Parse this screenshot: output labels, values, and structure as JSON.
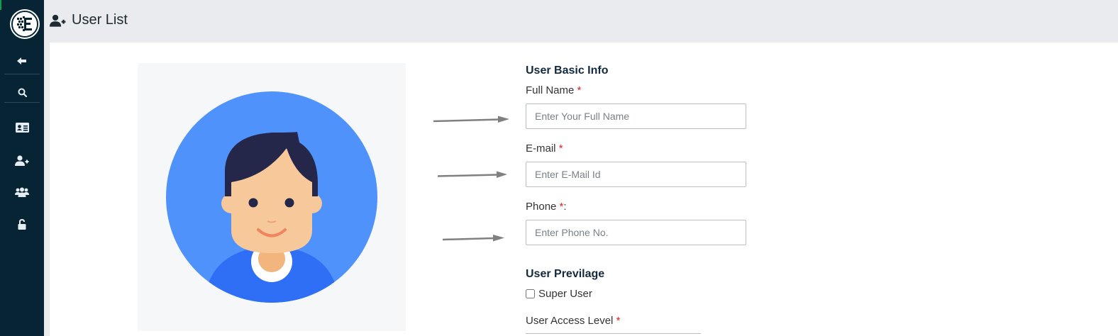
{
  "header": {
    "title": "User List",
    "title_icon": "user-plus-icon"
  },
  "sidebar": {
    "logo": "app-logo",
    "items": [
      {
        "name": "back",
        "icon": "arrow-left-icon"
      },
      {
        "name": "search",
        "icon": "search-icon"
      },
      {
        "name": "id-card",
        "icon": "id-card-icon"
      },
      {
        "name": "add-user",
        "icon": "user-plus-icon"
      },
      {
        "name": "users",
        "icon": "users-icon"
      },
      {
        "name": "unlock",
        "icon": "unlock-icon"
      }
    ]
  },
  "form": {
    "basic_info_title": "User Basic Info",
    "full_name": {
      "label": "Full Name",
      "required": "*",
      "placeholder": "Enter Your Full Name"
    },
    "email": {
      "label": "E-mail",
      "required": "*",
      "placeholder": "Enter E-Mail Id"
    },
    "phone": {
      "label": "Phone",
      "required": "*",
      "suffix": ":",
      "placeholder": "Enter Phone No."
    },
    "privilege_title": "User Previlage",
    "super_user_label": "Super User",
    "super_user_checked": false,
    "access_level": {
      "label": "User Access Level",
      "required": "*"
    }
  },
  "colors": {
    "sidebar_bg": "#072434",
    "avatar_circle": "#4f92fb",
    "required": "#e02020",
    "accent_green": "#0f9d4a"
  }
}
